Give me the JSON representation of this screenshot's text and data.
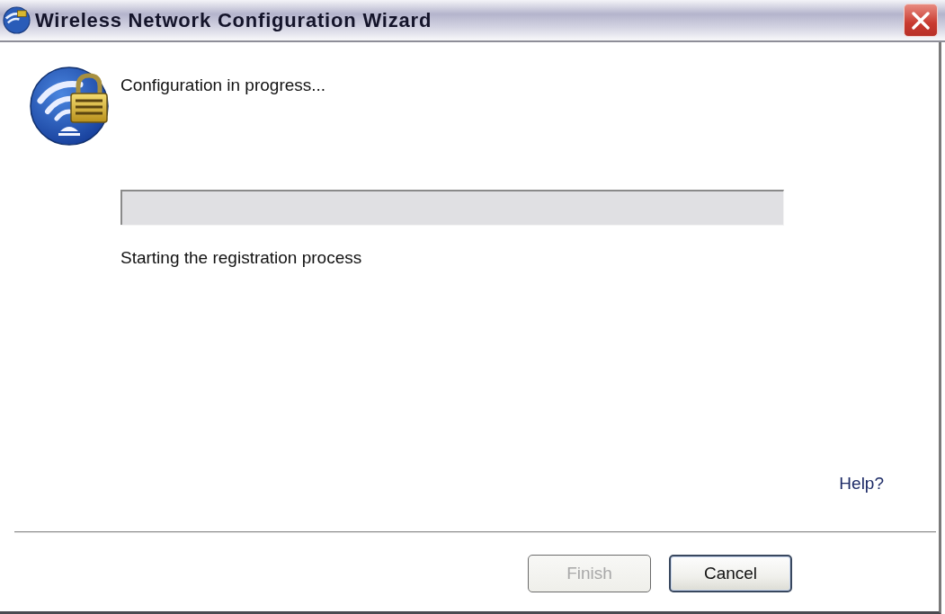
{
  "window": {
    "title": "Wireless Network Configuration Wizard"
  },
  "heading": "Configuration in progress...",
  "progress": {
    "level": 0
  },
  "status": "Starting the registration process",
  "help_link": "Help?",
  "buttons": [
    {
      "label": "Finish",
      "disabled": true
    },
    {
      "label": "Cancel",
      "disabled": false
    }
  ]
}
